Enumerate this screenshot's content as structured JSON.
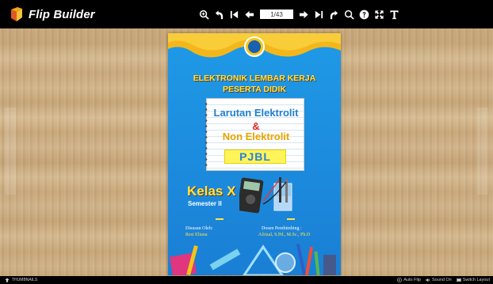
{
  "brand": {
    "name": "Flip Builder",
    "icon": "fire-book-icon"
  },
  "toolbar": {
    "page_value": "1/43",
    "tools_left": [
      {
        "icon": "zoom-in-icon"
      },
      {
        "icon": "undo-back-icon"
      },
      {
        "icon": "first-page-icon"
      },
      {
        "icon": "previous-page-icon"
      }
    ],
    "tools_right": [
      {
        "icon": "next-page-icon"
      },
      {
        "icon": "last-page-icon"
      },
      {
        "icon": "share-icon"
      },
      {
        "icon": "search-icon"
      },
      {
        "icon": "help-icon"
      },
      {
        "icon": "fullscreen-icon"
      },
      {
        "icon": "text-icon"
      }
    ]
  },
  "cover": {
    "title_line1": "ELEKTRONIK LEMBAR KERJA",
    "title_line2": "PESERTA DIDIK",
    "subject_line1": "Larutan Elektrolit",
    "ampersand": "&",
    "subject_line2": "Non Elektrolit",
    "model": "PJBL",
    "grade": "Kelas X",
    "semester": "Semester II",
    "author_label": "Disusun Oleh:",
    "author_name": "Resi Eliana",
    "supervisor_label": "Dosen Pembimbing :",
    "supervisor_name": "Afrizal, S.Pd., M.Sc., Ph.D"
  },
  "bottombar": {
    "thumbnails": "THUMBNAILS",
    "auto_flip": "Auto Flip",
    "sound": "Sound On",
    "switch_layout": "Switch Layout"
  },
  "colors": {
    "toolbar_bg": "#000000",
    "cover_blue": "#1d8fe0",
    "title_yellow": "#ffe24a"
  }
}
